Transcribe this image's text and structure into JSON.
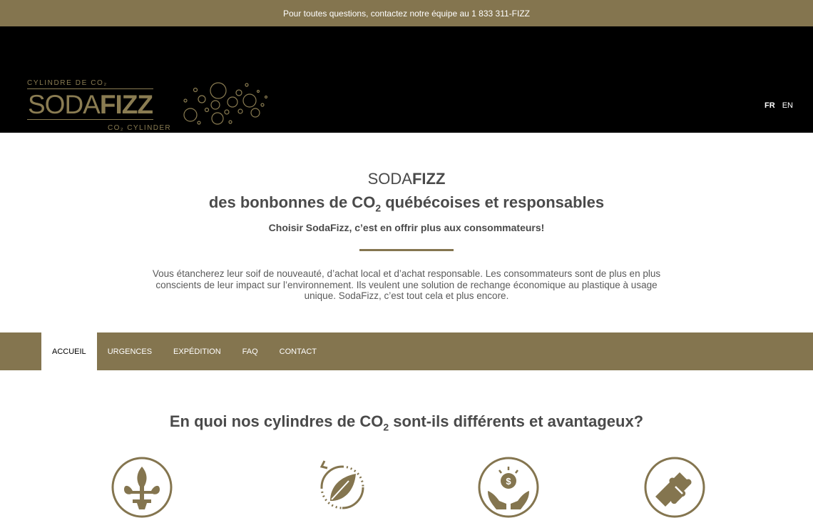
{
  "topbar": {
    "text": "Pour toutes questions, contactez notre équipe au 1 833 311-FIZZ"
  },
  "logo": {
    "top_text": "CYLINDRE DE CO₂",
    "soda": "SODA",
    "fizz": "FIZZ",
    "bottom_text": "CO₂ CYLINDER"
  },
  "lang": {
    "fr": "FR",
    "en": "EN",
    "active": "FR"
  },
  "intro": {
    "brand_light": "SODA",
    "brand_bold": "FIZZ",
    "headline_pre": "des bonbonnes de CO",
    "headline_sub": "2",
    "headline_post": " québécoises et responsables",
    "subheadline": "Choisir SodaFizz, c’est en offrir plus aux consommateurs!",
    "description": "Vous étancherez leur soif de nouveauté, d’achat local et d’achat responsable. Les consommateurs sont de plus en plus conscients de leur impact sur l’environnement. Ils veulent une solution de rechange économique au plastique à usage unique. SodaFizz, c’est tout cela et plus encore."
  },
  "nav": {
    "items": [
      {
        "label": "ACCUEIL",
        "active": true
      },
      {
        "label": "URGENCES"
      },
      {
        "label": "EXPÉDITION"
      },
      {
        "label": "FAQ"
      },
      {
        "label": "CONTACT"
      }
    ]
  },
  "section": {
    "title_pre": "En quoi nos cylindres de CO",
    "title_sub": "2",
    "title_post": " sont-ils différents et avantageux?"
  },
  "features": {
    "icons": [
      "fleur-de-lis-icon",
      "leaf-recycle-icon",
      "money-hands-icon",
      "puzzle-icon"
    ]
  },
  "colors": {
    "accent": "#84754f",
    "header_bg": "#000000",
    "text": "#4a4a4a"
  }
}
